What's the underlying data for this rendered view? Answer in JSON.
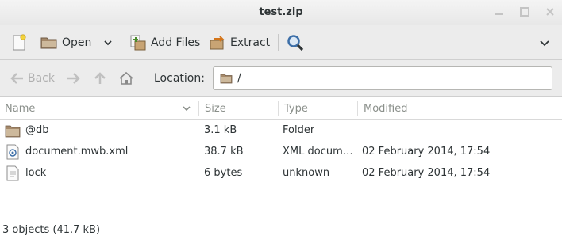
{
  "window": {
    "title": "test.zip"
  },
  "toolbar": {
    "new_icon": "new-archive-icon",
    "open_label": "Open",
    "add_files_label": "Add Files",
    "extract_label": "Extract",
    "search_icon": "search-icon",
    "menu_icon": "chevron-down-icon"
  },
  "navigation": {
    "back_label": "Back",
    "location_label": "Location:",
    "location_value": "/"
  },
  "columns": [
    "Name",
    "Size",
    "Type",
    "Modified"
  ],
  "files": [
    {
      "name": "@db",
      "size": "3.1 kB",
      "type": "Folder",
      "modified": "",
      "icon": "folder-icon"
    },
    {
      "name": "document.mwb.xml",
      "size": "38.7 kB",
      "type": "XML docum…",
      "modified": "02 February 2014, 17:54",
      "icon": "xml-file-icon"
    },
    {
      "name": "lock",
      "size": "6 bytes",
      "type": "unknown",
      "modified": "02 February 2014, 17:54",
      "icon": "text-file-icon"
    }
  ],
  "status": "3 objects (41.7 kB)",
  "colors": {
    "folder": "#a5896a",
    "accent": "#3d6fa8"
  }
}
